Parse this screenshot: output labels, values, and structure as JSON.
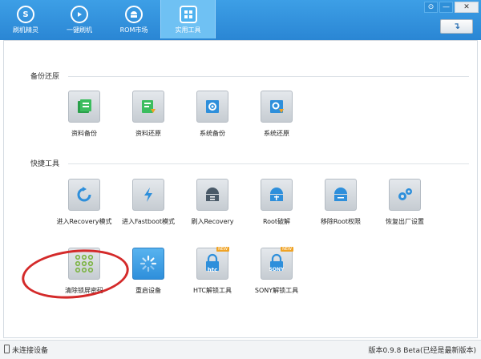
{
  "header": {
    "nav": [
      {
        "label": "刷机精灵",
        "icon": "logo-s-icon"
      },
      {
        "label": "一键刷机",
        "icon": "play-icon"
      },
      {
        "label": "ROM市场",
        "icon": "android-icon"
      },
      {
        "label": "实用工具",
        "icon": "grid-tools-icon",
        "active": true
      }
    ],
    "window_controls": [
      "pin-icon",
      "minimize-icon",
      "close-icon"
    ],
    "refresh_icon": "refresh-icon"
  },
  "backup_section": {
    "title": "备份还原",
    "tools": [
      {
        "label": "资料备份",
        "icon": "contacts-backup-icon"
      },
      {
        "label": "资料还原",
        "icon": "contacts-restore-icon"
      },
      {
        "label": "系统备份",
        "icon": "system-backup-icon"
      },
      {
        "label": "系统还原",
        "icon": "system-restore-icon"
      }
    ]
  },
  "quick_section": {
    "title": "快捷工具",
    "tools": [
      {
        "label": "进入Recovery模式",
        "icon": "refresh-arrow-icon"
      },
      {
        "label": "进入Fastboot模式",
        "icon": "lightning-icon"
      },
      {
        "label": "刷入Recovery",
        "icon": "android-flash-icon"
      },
      {
        "label": "Root破解",
        "icon": "android-root-icon"
      },
      {
        "label": "移除Root权限",
        "icon": "android-unroot-icon"
      },
      {
        "label": "恢复出厂设置",
        "icon": "gears-icon"
      },
      {
        "label": "清除锁屏密码",
        "icon": "pattern-lock-icon"
      },
      {
        "label": "重启设备",
        "icon": "reboot-spinner-icon"
      },
      {
        "label": "HTC解锁工具",
        "icon": "htc-lock-icon",
        "brand": "htc",
        "badge": "NEW"
      },
      {
        "label": "SONY解锁工具",
        "icon": "sony-lock-icon",
        "brand": "SONY",
        "badge": "NEW"
      }
    ]
  },
  "status": {
    "connection": "未连接设备",
    "version": "版本0.9.8 Beta(已经是最新版本)"
  },
  "colors": {
    "header_blue": "#2a86d4",
    "active_tab": "#6fc1f3",
    "tile_blue": "#2e8fdb",
    "highlight_red": "#d42a2a"
  }
}
